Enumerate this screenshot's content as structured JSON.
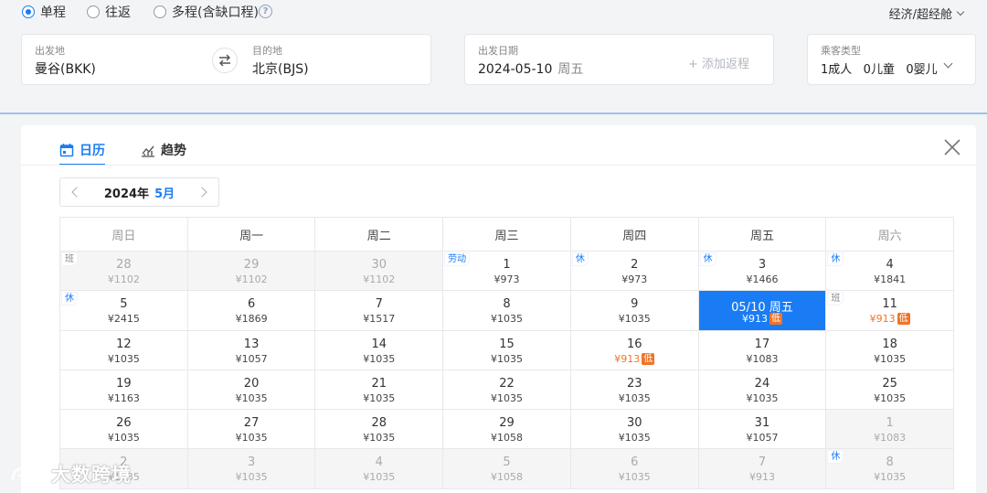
{
  "trip_types": [
    {
      "label": "单程",
      "selected": true
    },
    {
      "label": "往返",
      "selected": false
    },
    {
      "label": "多程(含缺口程)",
      "selected": false
    }
  ],
  "help_glyph": "?",
  "cabin": "经济/超经舱",
  "search": {
    "from_label": "出发地",
    "from_value": "曼谷(BKK)",
    "to_label": "目的地",
    "to_value": "北京(BJS)",
    "date_label": "出发日期",
    "date_value": "2024-05-10",
    "date_weekday": "周五",
    "add_return": "+ 添加返程",
    "pax_label": "乘客类型",
    "pax_value": "1成人   0儿童   0婴儿"
  },
  "tabs": [
    {
      "label": "日历",
      "active": true,
      "icon": "calendar-icon"
    },
    {
      "label": "趋势",
      "active": false,
      "icon": "trend-chart-icon"
    }
  ],
  "month_nav": {
    "year": "2024年",
    "month": "5月"
  },
  "weekdays": [
    "周日",
    "周一",
    "周二",
    "周三",
    "周四",
    "周五",
    "周六"
  ],
  "weeks": [
    [
      {
        "day": "28",
        "price": "¥1102",
        "other": true,
        "tag": "班"
      },
      {
        "day": "29",
        "price": "¥1102",
        "other": true
      },
      {
        "day": "30",
        "price": "¥1102",
        "other": true
      },
      {
        "day": "1",
        "price": "¥973",
        "tag": "劳动"
      },
      {
        "day": "2",
        "price": "¥973",
        "tag": "休"
      },
      {
        "day": "3",
        "price": "¥1466",
        "tag": "休"
      },
      {
        "day": "4",
        "price": "¥1841",
        "tag": "休"
      }
    ],
    [
      {
        "day": "5",
        "price": "¥2415",
        "tag": "休"
      },
      {
        "day": "6",
        "price": "¥1869"
      },
      {
        "day": "7",
        "price": "¥1517"
      },
      {
        "day": "8",
        "price": "¥1035"
      },
      {
        "day": "9",
        "price": "¥1035"
      },
      {
        "day": "05/10 周五",
        "price": "¥913",
        "low": true,
        "selected": true
      },
      {
        "day": "11",
        "price": "¥913",
        "low": true,
        "tag": "班"
      }
    ],
    [
      {
        "day": "12",
        "price": "¥1035"
      },
      {
        "day": "13",
        "price": "¥1057"
      },
      {
        "day": "14",
        "price": "¥1035"
      },
      {
        "day": "15",
        "price": "¥1035"
      },
      {
        "day": "16",
        "price": "¥913",
        "low": true
      },
      {
        "day": "17",
        "price": "¥1083"
      },
      {
        "day": "18",
        "price": "¥1035"
      }
    ],
    [
      {
        "day": "19",
        "price": "¥1163"
      },
      {
        "day": "20",
        "price": "¥1035"
      },
      {
        "day": "21",
        "price": "¥1035"
      },
      {
        "day": "22",
        "price": "¥1035"
      },
      {
        "day": "23",
        "price": "¥1035"
      },
      {
        "day": "24",
        "price": "¥1035"
      },
      {
        "day": "25",
        "price": "¥1035"
      }
    ],
    [
      {
        "day": "26",
        "price": "¥1035"
      },
      {
        "day": "27",
        "price": "¥1035"
      },
      {
        "day": "28",
        "price": "¥1035"
      },
      {
        "day": "29",
        "price": "¥1058"
      },
      {
        "day": "30",
        "price": "¥1035"
      },
      {
        "day": "31",
        "price": "¥1057"
      },
      {
        "day": "1",
        "price": "¥1083",
        "other": true
      }
    ],
    [
      {
        "day": "2",
        "price": "¥1035",
        "other": true
      },
      {
        "day": "3",
        "price": "¥1035",
        "other": true
      },
      {
        "day": "4",
        "price": "¥1035",
        "other": true
      },
      {
        "day": "5",
        "price": "¥1058",
        "other": true
      },
      {
        "day": "6",
        "price": "¥1035",
        "other": true
      },
      {
        "day": "7",
        "price": "¥913",
        "other": true
      },
      {
        "day": "8",
        "price": "¥1035",
        "other": true,
        "tag": "休"
      }
    ]
  ],
  "low_label": "低",
  "watermark": "大数跨境",
  "colors": {
    "accent": "#1a7cf5",
    "low_price": "#f07427"
  }
}
